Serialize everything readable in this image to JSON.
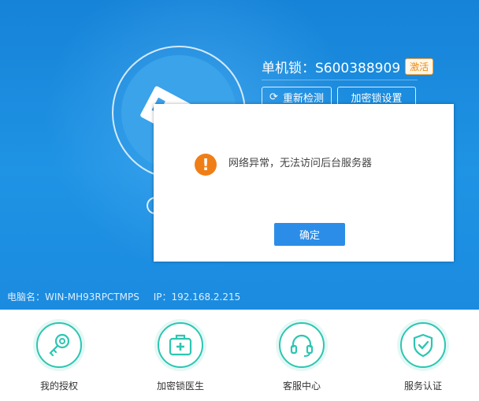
{
  "header": {
    "lock_label": "单机锁：S600388909",
    "activate_badge": "激活",
    "redetect_button": "重新检测",
    "settings_button": "加密锁设置"
  },
  "pc_info": {
    "computer_name": "电脑名：WIN-MH93RPCTMPS",
    "ip": "IP：192.168.2.215"
  },
  "shortcuts": [
    {
      "label": "我的授权",
      "icon": "key-icon"
    },
    {
      "label": "加密锁医生",
      "icon": "medical-kit-icon"
    },
    {
      "label": "客服中心",
      "icon": "headset-icon"
    },
    {
      "label": "服务认证",
      "icon": "shield-check-icon"
    }
  ],
  "dialog": {
    "message": "网络异常，无法访问后台服务器",
    "ok_button": "确定",
    "icon": "warning-icon"
  },
  "colors": {
    "accent_blue": "#1f93e4",
    "teal": "#2cc6b1",
    "warning_orange": "#f07e16",
    "button_blue": "#2c8de8"
  }
}
